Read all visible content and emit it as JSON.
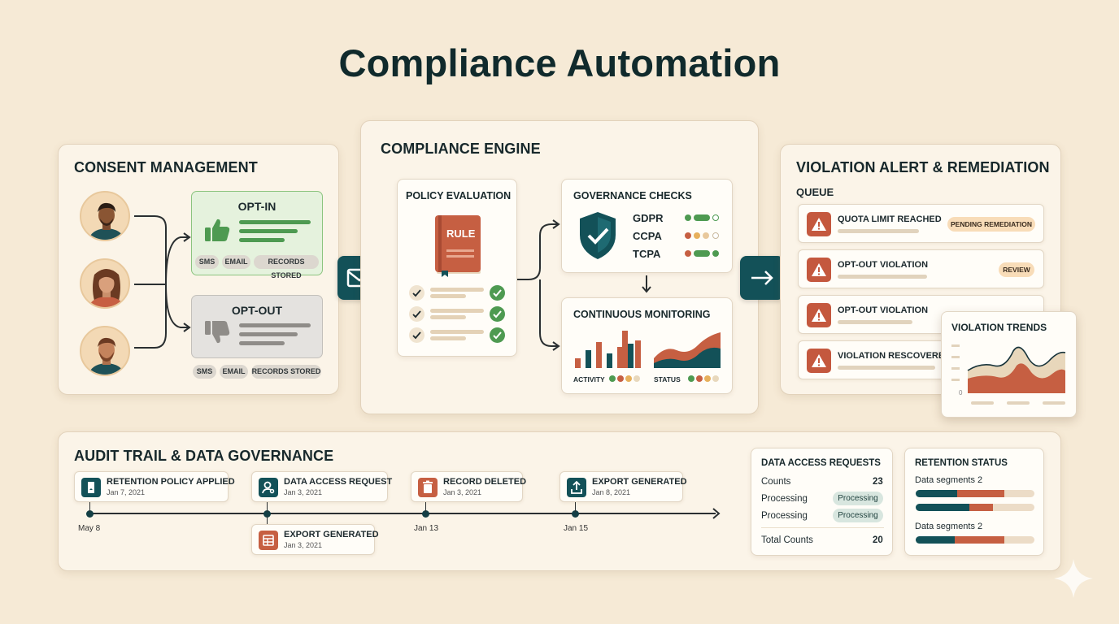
{
  "title": "Compliance Automation",
  "consent": {
    "heading": "CONSENT MANAGEMENT",
    "optin": {
      "title": "OPT-IN",
      "chips": [
        "SMS",
        "EMAIL",
        "RECORDS STORED"
      ]
    },
    "optout": {
      "title": "OPT-OUT",
      "chips": [
        "SMS",
        "EMAIL",
        "RECORDS STORED"
      ]
    }
  },
  "engine": {
    "heading": "COMPLIANCE ENGINE",
    "policy": {
      "title": "POLICY EVALUATION",
      "book_label": "RULE"
    },
    "governance": {
      "title": "GOVERNANCE CHECKS",
      "items": [
        "GDPR",
        "CCPA",
        "TCPA"
      ]
    },
    "monitoring": {
      "title": "CONTINUOUS MONITORING",
      "activity_label": "ACTIVITY",
      "status_label": "STATUS"
    }
  },
  "violations": {
    "heading": "VIOLATION ALERT & REMEDIATION",
    "queue_label": "QUEUE",
    "items": [
      {
        "title": "QUOTA LIMIT REACHED",
        "badge": "PENDING REMEDIATION"
      },
      {
        "title": "OPT-OUT VIOLATION",
        "badge": "REVIEW"
      },
      {
        "title": "OPT-OUT VIOLATION",
        "badge": ""
      },
      {
        "title": "VIOLATION RESCOVERED",
        "badge": ""
      }
    ],
    "trends": {
      "title": "VIOLATION TRENDS",
      "zero_tick": "0"
    }
  },
  "audit": {
    "heading": "AUDIT TRAIL & DATA GOVERNANCE",
    "events": [
      {
        "title": "RETENTION POLICY APPLIED",
        "date": "Jan 7, 2021"
      },
      {
        "title": "DATA ACCESS REQUEST",
        "date": "Jan 3, 2021"
      },
      {
        "title": "RECORD DELETED",
        "date": "Jan 3, 2021"
      },
      {
        "title": "EXPORT GENERATED",
        "date": "Jan 8, 2021"
      },
      {
        "title": "EXPORT GENERATED",
        "date": "Jan 3, 2021"
      }
    ],
    "timeline_labels": [
      "May 8",
      "Jan 13",
      "Jan 15"
    ]
  },
  "data_access": {
    "title": "DATA ACCESS REQUESTS",
    "rows": [
      {
        "label": "Counts",
        "value": "23"
      },
      {
        "label": "Processing",
        "pill": "Processing"
      },
      {
        "label": "Processing",
        "pill": "Processing"
      }
    ],
    "total_label": "Total Counts",
    "total_value": "20"
  },
  "retention": {
    "title": "RETENTION STATUS",
    "group1_label": "Data segments 2",
    "group2_label": "Data segments 2",
    "segments": [
      {
        "teal": 0.35,
        "orange": 0.4
      },
      {
        "teal": 0.45,
        "orange": 0.2
      },
      {
        "teal": 0.33,
        "orange": 0.42
      }
    ]
  },
  "colors": {
    "teal": "#135158",
    "orange": "#c65f42",
    "green": "#4e9a51",
    "sand": "#e8c89c",
    "background": "#f6ead6"
  }
}
